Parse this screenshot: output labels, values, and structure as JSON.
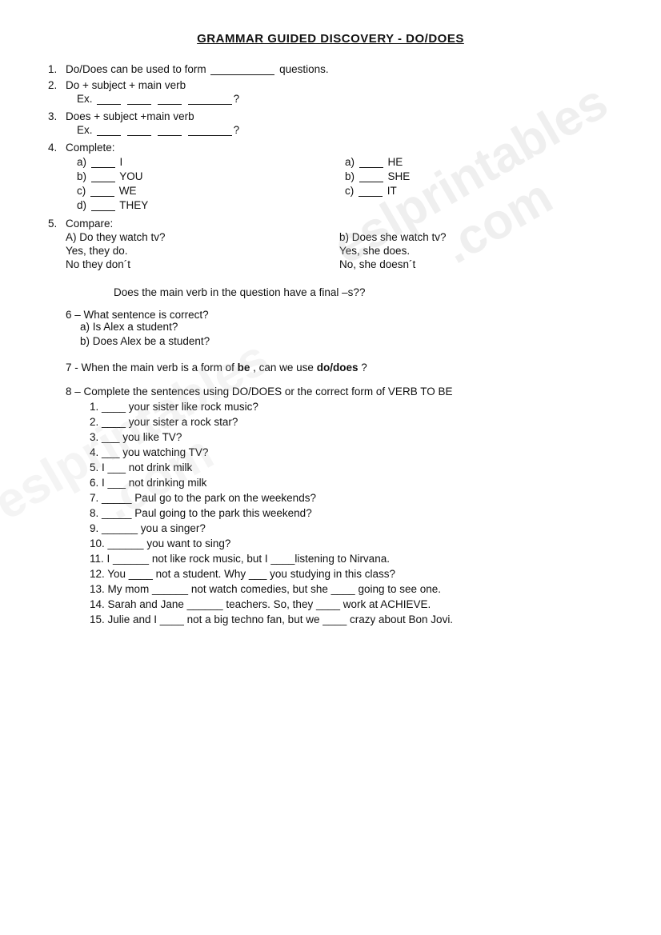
{
  "title": "GRAMMAR GUIDED DISCOVERY - DO/DOES",
  "watermark": "eslprintables\n.com",
  "sections": {
    "q1": "Do/Does can be used to form",
    "q1_blank": "",
    "q1_end": "questions.",
    "q2": "Do + subject + main verb",
    "q2_ex": "Ex.",
    "q3": "Does + subject +main verb",
    "q3_ex": "Ex.",
    "q4_label": "Complete:",
    "q4_a_left": "a)  ____ I",
    "q4_b_left": "b)  ____ YOU",
    "q4_c_left": "c)  ____ WE",
    "q4_d_left": "d)  ____ THEY",
    "q4_a_right": "a) _____ HE",
    "q4_b_right": "b) _____ SHE",
    "q4_c_right": "c) _____ IT",
    "q5_label": "Compare:",
    "q5_left_q": "A)  Do they watch tv?",
    "q5_left_yes": "Yes, they do.",
    "q5_left_no": "No they don´t",
    "q5_right_q": "b) Does she watch tv?",
    "q5_right_yes": "Yes, she does.",
    "q5_right_no": "No, she doesn´t",
    "q5_question": "Does the main verb in the question have a final –s??",
    "q6_label": "6 –    What sentence is correct?",
    "q6_a": "a)  Is Alex a student?",
    "q6_b": "b)  Does Alex be a student?",
    "q7": "7 - When the main verb is a form of",
    "q7_be": "be",
    "q7_mid": ", can we use",
    "q7_dodes": "do/does",
    "q7_end": "?",
    "q8_label": "8 – Complete the sentences using DO/DOES or the correct form of VERB TO BE",
    "sentences": [
      "1.  ____ your sister like rock music?",
      "2.  ____ your sister a rock star?",
      "3.  ___ you like TV?",
      "4.  ___ you watching TV?",
      "5.  I ___ not drink milk",
      "6.  I ___ not drinking milk",
      "7.  _____ Paul go to the park on the weekends?",
      "8.  _____ Paul going to the park this weekend?",
      "9.  ______ you a singer?",
      "10.  ______ you want to sing?",
      "11.  I ______ not like rock music, but I ____listening to Nirvana.",
      "12.  You ____ not a student. Why ___ you studying in this class?",
      "13.  My mom ______ not watch comedies, but she ____ going to see one.",
      "14.  Sarah and Jane ______ teachers. So, they ____ work at ACHIEVE.",
      "15.  Julie and I ____ not a big techno fan, but we ____ crazy about Bon Jovi."
    ]
  }
}
